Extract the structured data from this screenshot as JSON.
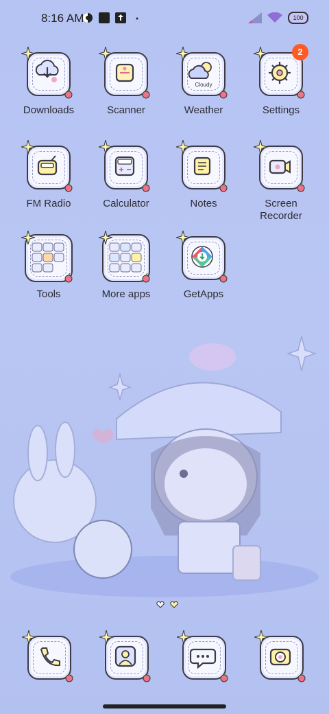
{
  "statusbar": {
    "time": "8:16 AM",
    "battery": "100"
  },
  "apps": [
    {
      "id": "downloads",
      "label": "Downloads"
    },
    {
      "id": "scanner",
      "label": "Scanner"
    },
    {
      "id": "weather",
      "label": "Weather",
      "sublabel": "Cloudy"
    },
    {
      "id": "settings",
      "label": "Settings",
      "badge": "2"
    },
    {
      "id": "fm-radio",
      "label": "FM Radio"
    },
    {
      "id": "calculator",
      "label": "Calculator"
    },
    {
      "id": "notes",
      "label": "Notes"
    },
    {
      "id": "screen-recorder",
      "label_line1": "Screen",
      "label_line2": "Recorder"
    },
    {
      "id": "tools",
      "label": "Tools"
    },
    {
      "id": "more-apps",
      "label": "More apps"
    },
    {
      "id": "getapps",
      "label": "GetApps"
    }
  ],
  "dock": [
    {
      "id": "phone",
      "icon": "phone-icon"
    },
    {
      "id": "contacts",
      "icon": "contacts-icon"
    },
    {
      "id": "messages",
      "icon": "chat-icon"
    },
    {
      "id": "camera",
      "icon": "camera-icon"
    }
  ],
  "colors": {
    "background": "#b6c4f4",
    "badge": "#ff5a24",
    "tile": "#f6f7ff",
    "tile_border": "#3c3b45"
  }
}
